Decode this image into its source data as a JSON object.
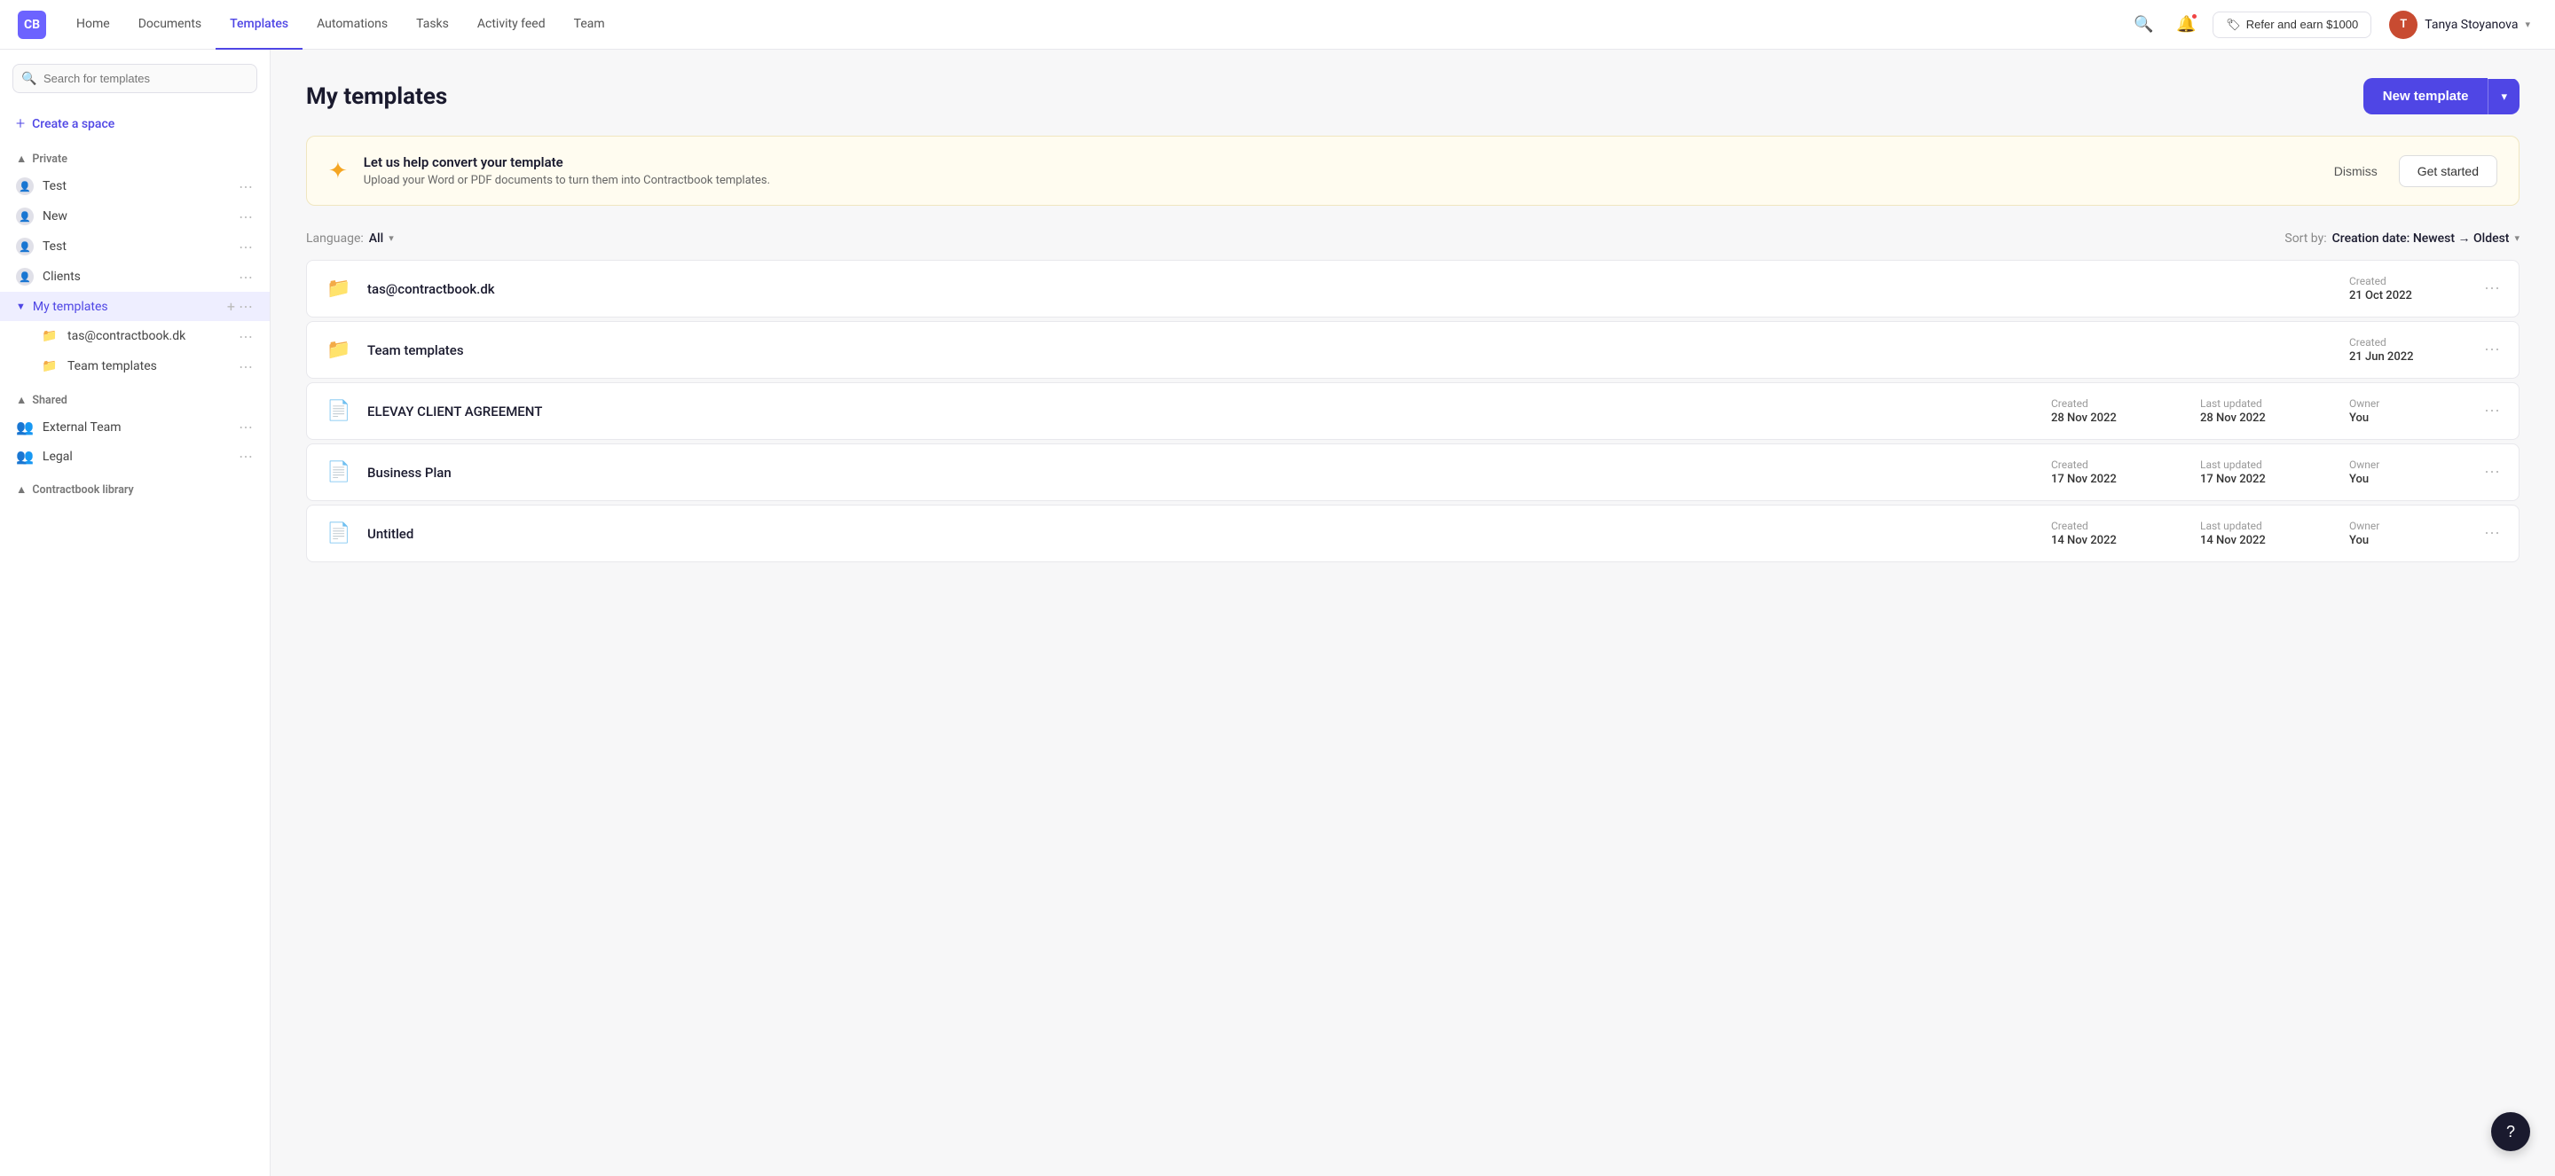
{
  "nav": {
    "logo_text": "CB",
    "links": [
      "Home",
      "Documents",
      "Templates",
      "Automations",
      "Tasks",
      "Activity feed",
      "Team"
    ],
    "active_link": "Templates",
    "refer_label": "Refer and earn $1000",
    "user_name": "Tanya Stoyanova",
    "user_initials": "T"
  },
  "sidebar": {
    "search_placeholder": "Search for templates",
    "create_space_label": "Create a space",
    "private_section": "Private",
    "private_items": [
      {
        "label": "Test"
      },
      {
        "label": "New"
      },
      {
        "label": "Test"
      },
      {
        "label": "Clients"
      }
    ],
    "my_templates_label": "My templates",
    "sub_items": [
      {
        "label": "tas@contractbook.dk"
      },
      {
        "label": "Team templates"
      }
    ],
    "shared_section": "Shared",
    "shared_items": [
      {
        "label": "External Team"
      },
      {
        "label": "Legal"
      }
    ],
    "library_section": "Contractbook library"
  },
  "content": {
    "page_title": "My templates",
    "new_template_label": "New template",
    "banner": {
      "title": "Let us help convert your template",
      "desc": "Upload your Word or PDF documents to turn them into Contractbook templates.",
      "dismiss_label": "Dismiss",
      "start_label": "Get started"
    },
    "filter": {
      "lang_label": "Language:",
      "lang_value": "All",
      "sort_label": "Sort by:",
      "sort_value": "Creation date: Newest → Oldest"
    },
    "templates": [
      {
        "icon": "📁",
        "name": "tas@contractbook.dk",
        "created_label": "Created",
        "created": "21 Oct 2022",
        "last_updated_label": "",
        "last_updated": "",
        "owner_label": "",
        "owner": ""
      },
      {
        "icon": "📁",
        "name": "Team templates",
        "created_label": "Created",
        "created": "21 Jun 2022",
        "last_updated_label": "",
        "last_updated": "",
        "owner_label": "",
        "owner": ""
      },
      {
        "icon": "📄",
        "name": "ELEVAY CLIENT AGREEMENT",
        "created_label": "Created",
        "created": "28 Nov 2022",
        "last_updated_label": "Last updated",
        "last_updated": "28 Nov 2022",
        "owner_label": "Owner",
        "owner": "You"
      },
      {
        "icon": "📄",
        "name": "Business Plan",
        "created_label": "Created",
        "created": "17 Nov 2022",
        "last_updated_label": "Last updated",
        "last_updated": "17 Nov 2022",
        "owner_label": "Owner",
        "owner": "You"
      },
      {
        "icon": "📄",
        "name": "Untitled",
        "created_label": "Created",
        "created": "14 Nov 2022",
        "last_updated_label": "Last updated",
        "last_updated": "14 Nov 2022",
        "owner_label": "Owner",
        "owner": "You"
      }
    ]
  }
}
